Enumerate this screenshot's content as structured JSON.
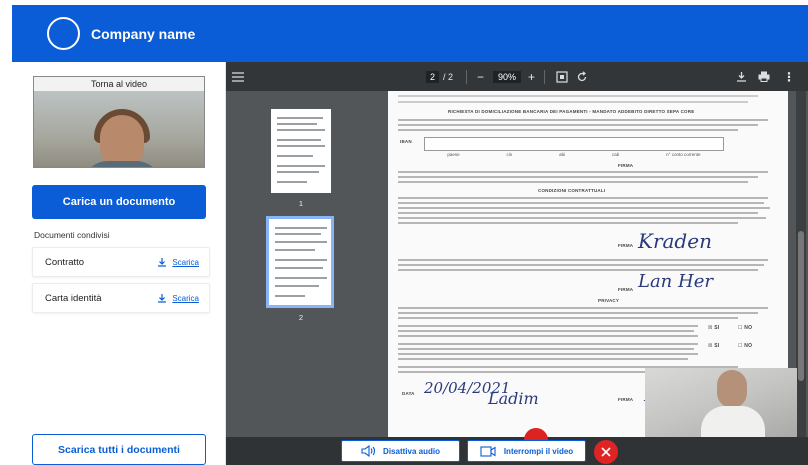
{
  "header": {
    "company_name": "Company name"
  },
  "sidebar": {
    "video_label": "Torna al video",
    "upload_button": "Carica un documento",
    "shared_title": "Documenti condivisi",
    "documents": [
      {
        "name": "Contratto",
        "action": "Scarica"
      },
      {
        "name": "Carta identità",
        "action": "Scarica"
      }
    ],
    "download_all_button": "Scarica tutti i documenti"
  },
  "viewer": {
    "current_page": "2",
    "page_separator": "/",
    "total_pages": "2",
    "zoom": "90%",
    "thumbnails": [
      {
        "num": "1"
      },
      {
        "num": "2"
      }
    ],
    "doc": {
      "heading": "RICHIESTA DI DOMICILIAZIONE BANCARIA DEI PAGAMENTI - MANDATO ADDEBITO DIRETTO SEPA CORE",
      "iban_label": "IBAN",
      "iban_fields": [
        "paese",
        "cin",
        "abi",
        "cab",
        "n° conto corrente"
      ],
      "firma": "FIRMA",
      "conditions_heading": "CONDIZIONI CONTRATTUALI",
      "privacy_heading": "PRIVACY",
      "si": "SI",
      "no": "NO",
      "data_label": "DATA",
      "date_value": "20/04/2021"
    }
  },
  "controls": {
    "audio_button": "Disattiva audio",
    "video_button": "Interrompi il video"
  },
  "colors": {
    "accent": "#0a5dd6",
    "danger": "#e02424"
  }
}
